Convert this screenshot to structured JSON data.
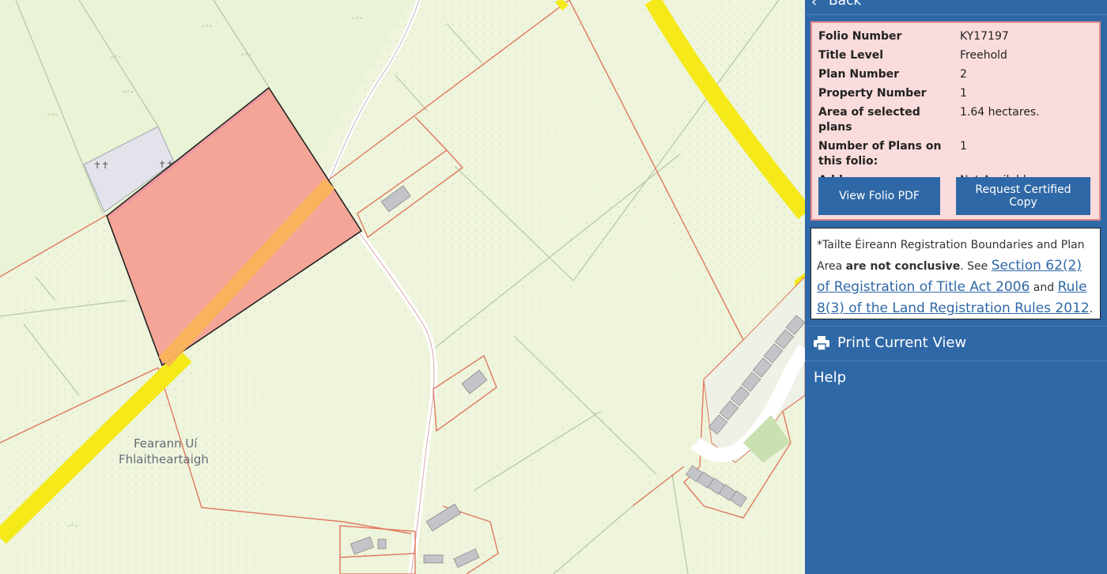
{
  "map": {
    "place_label_line1": "Fearann Uí",
    "place_label_line2": "Fhlaitheartaigh"
  },
  "panel": {
    "back_label": "Back",
    "folio": {
      "rows": [
        {
          "key": "Folio Number",
          "value": "KY17197"
        },
        {
          "key": "Title Level",
          "value": "Freehold"
        },
        {
          "key": "Plan Number",
          "value": "2"
        },
        {
          "key": "Property Number",
          "value": "1"
        },
        {
          "key": "Area of selected plans",
          "value": "1.64 hectares."
        },
        {
          "key": "Number of Plans on this folio:",
          "value": "1"
        },
        {
          "key": "Address",
          "value": "Not Available"
        }
      ],
      "view_pdf_label": "View Folio PDF",
      "request_copy_label": "Request Certified Copy"
    },
    "notice": {
      "prefix": "*Tailte Éireann Registration Boundaries and Plan Area",
      "bold": "are not conclusive",
      "see": ". See",
      "link1": "Section 62(2) of Registration of Title Act 2006",
      "and": "and",
      "link2": "Rule 8(3) of the Land Registration Rules 2012",
      "end": "."
    },
    "print_label": "Print Current View",
    "help_label": "Help"
  }
}
